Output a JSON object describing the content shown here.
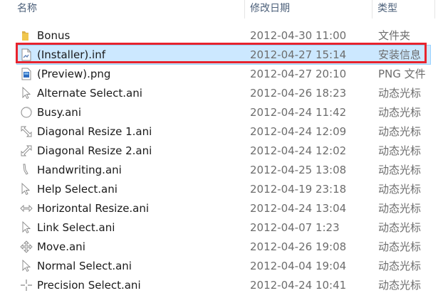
{
  "columns": {
    "name": "名称",
    "date": "修改日期",
    "type": "类型"
  },
  "files": [
    {
      "name": "Bonus",
      "date": "2012-04-30 11:00",
      "type": "文件夹",
      "icon": "folder-icon"
    },
    {
      "name": "(Installer).inf",
      "date": "2012-04-27 15:14",
      "type": "安装信息",
      "icon": "setup-info-file-icon",
      "selected": true
    },
    {
      "name": "(Preview).png",
      "date": "2012-04-27 20:10",
      "type": "PNG 文件",
      "icon": "image-file-icon"
    },
    {
      "name": "Alternate Select.ani",
      "date": "2012-04-26 18:23",
      "type": "动态光标",
      "icon": "cursor-alternate-select-icon"
    },
    {
      "name": "Busy.ani",
      "date": "2012-04-24 11:42",
      "type": "动态光标",
      "icon": "cursor-busy-icon"
    },
    {
      "name": "Diagonal Resize 1.ani",
      "date": "2012-04-24 12:09",
      "type": "动态光标",
      "icon": "cursor-diagonal-resize-1-icon"
    },
    {
      "name": "Diagonal Resize 2.ani",
      "date": "2012-04-24 12:02",
      "type": "动态光标",
      "icon": "cursor-diagonal-resize-2-icon"
    },
    {
      "name": "Handwriting.ani",
      "date": "2012-04-25 13:08",
      "type": "动态光标",
      "icon": "cursor-handwriting-icon"
    },
    {
      "name": "Help Select.ani",
      "date": "2012-04-19 23:18",
      "type": "动态光标",
      "icon": "cursor-help-select-icon"
    },
    {
      "name": "Horizontal Resize.ani",
      "date": "2012-04-24 13:04",
      "type": "动态光标",
      "icon": "cursor-horizontal-resize-icon"
    },
    {
      "name": "Link Select.ani",
      "date": "2012-04-07 1:23",
      "type": "动态光标",
      "icon": "cursor-link-select-icon"
    },
    {
      "name": "Move.ani",
      "date": "2012-04-26 19:08",
      "type": "动态光标",
      "icon": "cursor-move-icon"
    },
    {
      "name": "Normal Select.ani",
      "date": "2012-04-04 19:04",
      "type": "动态光标",
      "icon": "cursor-normal-select-icon"
    },
    {
      "name": "Precision Select.ani",
      "date": "2012-04-24 10:41",
      "type": "动态光标",
      "icon": "cursor-precision-select-icon"
    }
  ],
  "colors": {
    "selection": "#cce8ff",
    "highlight": "#e8232d",
    "header_text": "#4c607a"
  }
}
